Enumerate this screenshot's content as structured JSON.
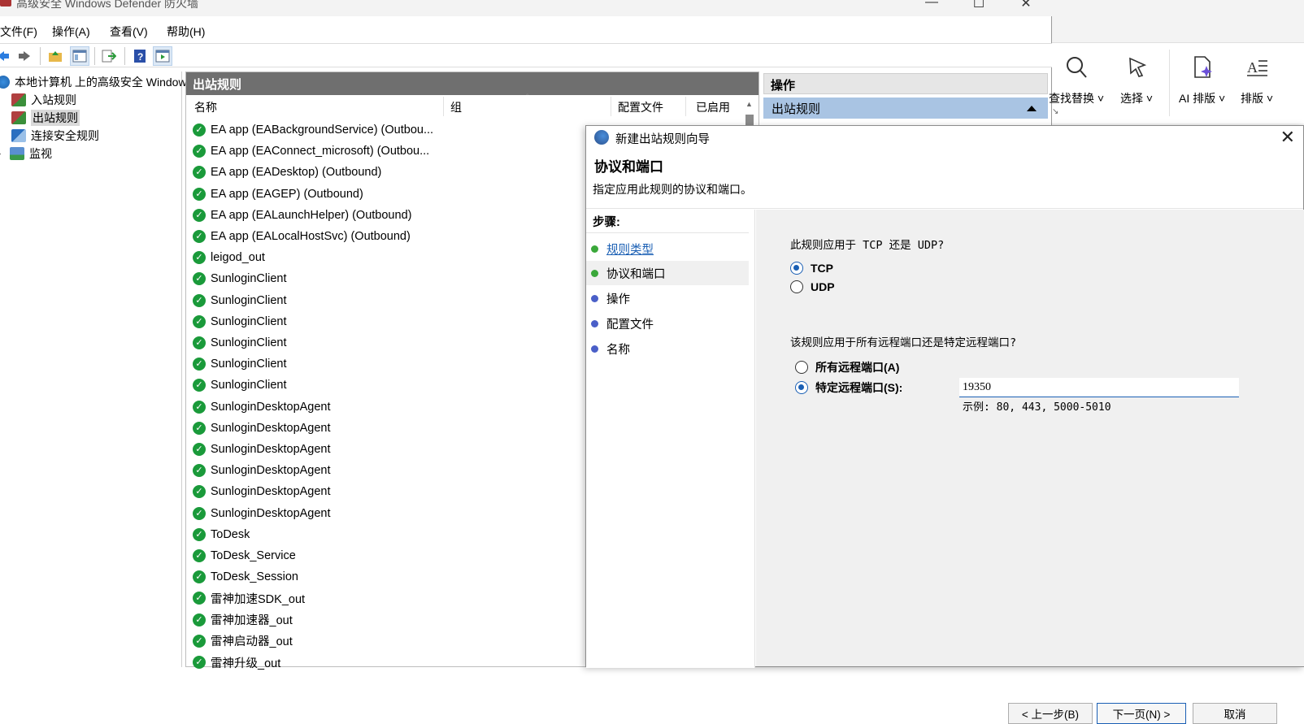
{
  "window": {
    "title": "高级安全 Windows Defender 防火墙"
  },
  "menu": [
    "文件(F)",
    "操作(A)",
    "查看(V)",
    "帮助(H)"
  ],
  "tree": {
    "root": "本地计算机 上的高级安全 Windows",
    "items": [
      "入站规则",
      "出站规则",
      "连接安全规则",
      "监视"
    ]
  },
  "list": {
    "header": "出站规则",
    "columns": [
      "名称",
      "组",
      "配置文件",
      "已启用"
    ],
    "rows": [
      "EA app (EABackgroundService) (Outbou...",
      "EA app (EAConnect_microsoft) (Outbou...",
      "EA app (EADesktop) (Outbound)",
      "EA app (EAGEP) (Outbound)",
      "EA app (EALaunchHelper) (Outbound)",
      "EA app (EALocalHostSvc) (Outbound)",
      "leigod_out",
      "SunloginClient",
      "SunloginClient",
      "SunloginClient",
      "SunloginClient",
      "SunloginClient",
      "SunloginClient",
      "SunloginDesktopAgent",
      "SunloginDesktopAgent",
      "SunloginDesktopAgent",
      "SunloginDesktopAgent",
      "SunloginDesktopAgent",
      "SunloginDesktopAgent",
      "ToDesk",
      "ToDesk_Service",
      "ToDesk_Session",
      "雷神加速SDK_out",
      "雷神加速器_out",
      "雷神启动器_out",
      "雷神升级_out"
    ]
  },
  "actions": {
    "header": "操作",
    "section": "出站规则"
  },
  "ribbon": {
    "buttons": [
      "查找替换",
      "选择",
      "AI 排版",
      "排版"
    ]
  },
  "wizard": {
    "title": "新建出站规则向导",
    "heading": "协议和端口",
    "subheading": "指定应用此规则的协议和端口。",
    "steps_label": "步骤:",
    "steps": [
      "规则类型",
      "协议和端口",
      "操作",
      "配置文件",
      "名称"
    ],
    "question_protocol": "此规则应用于 TCP 还是 UDP?",
    "protocol_options": [
      "TCP",
      "UDP"
    ],
    "protocol_selected": "TCP",
    "question_ports": "该规则应用于所有远程端口还是特定远程端口?",
    "port_options": [
      "所有远程端口(A)",
      "特定远程端口(S):"
    ],
    "port_value": "19350",
    "port_hint": "示例: 80, 443, 5000-5010",
    "buttons": {
      "back": "< 上一步(B)",
      "next": "下一页(N) >",
      "cancel": "取消"
    }
  }
}
